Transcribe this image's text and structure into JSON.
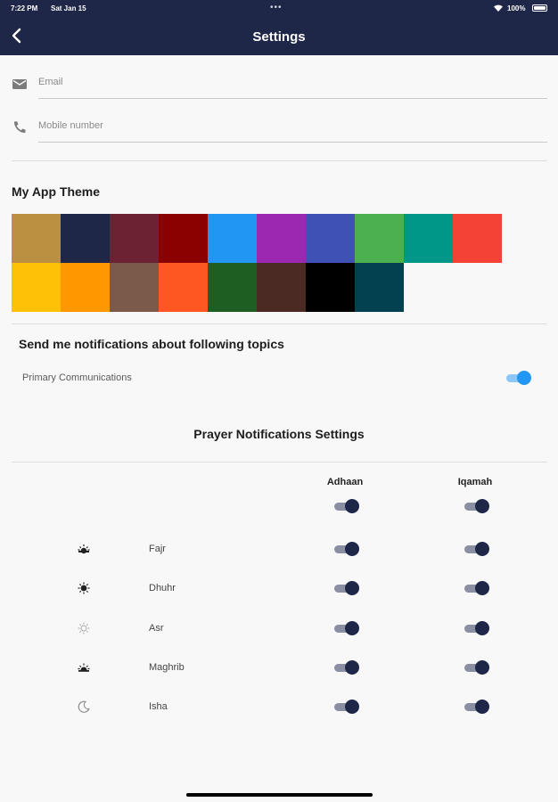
{
  "status_bar": {
    "time": "7:22 PM",
    "date": "Sat Jan 15",
    "dots": "•••",
    "battery": "100%"
  },
  "header": {
    "title": "Settings",
    "back_icon": "chevron-left-icon"
  },
  "contact": {
    "email": {
      "placeholder": "Email",
      "icon": "mail-icon"
    },
    "mobile": {
      "placeholder": "Mobile number",
      "icon": "phone-icon"
    }
  },
  "theme": {
    "title": "My App Theme",
    "colors": [
      "#bb9040",
      "#1f2748",
      "#6d2234",
      "#8b0000",
      "#2196f3",
      "#9c27b0",
      "#3f51b5",
      "#4caf50",
      "#009688",
      "#f44336",
      "#ffc107",
      "#ff9800",
      "#7b5a4c",
      "#ff5722",
      "#1e5e23",
      "#4b2a24",
      "#000000",
      "#044150"
    ]
  },
  "notifications": {
    "title": "Send me notifications about following topics",
    "primary_label": "Primary Communications",
    "primary_enabled": true
  },
  "prayer": {
    "title": "Prayer Notifications Settings",
    "col_adhaan": "Adhaan",
    "col_iqamah": "Iqamah",
    "all_adhaan": true,
    "all_iqamah": true,
    "rows": [
      {
        "name": "Fajr",
        "icon": "sunrise-icon",
        "adhaan": true,
        "iqamah": true
      },
      {
        "name": "Dhuhr",
        "icon": "sun-icon",
        "adhaan": true,
        "iqamah": true
      },
      {
        "name": "Asr",
        "icon": "sun-outline-icon",
        "adhaan": true,
        "iqamah": true
      },
      {
        "name": "Maghrib",
        "icon": "sunset-icon",
        "adhaan": true,
        "iqamah": true
      },
      {
        "name": "Isha",
        "icon": "moon-icon",
        "adhaan": true,
        "iqamah": true
      }
    ]
  },
  "accent_colors": {
    "appbar": "#1f2748",
    "toggle_primary": "#2196f3",
    "toggle_prayer": "#1f2748"
  }
}
